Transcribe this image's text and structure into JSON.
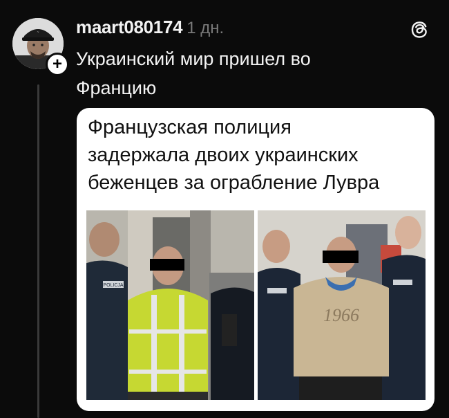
{
  "post": {
    "username": "maart080174",
    "timestamp": "1 дн.",
    "text_line1": "Украинский мир пришел во",
    "text_line2": "Францию"
  },
  "card": {
    "headline_line1": "Французская полиция",
    "headline_line2": "задержала двоих украинских",
    "headline_line3": "беженцев за ограбление Лувра"
  },
  "photo_left": {
    "vest_text": "POLICJA"
  },
  "photo_right": {
    "sweatshirt_print": "1966"
  },
  "colors": {
    "background": "#0b0b0b",
    "text": "#f3f3f3",
    "muted": "#7a7a7a",
    "card": "#ffffff"
  },
  "icons": [
    "threads-logo-icon",
    "follow-plus-icon",
    "avatar"
  ]
}
